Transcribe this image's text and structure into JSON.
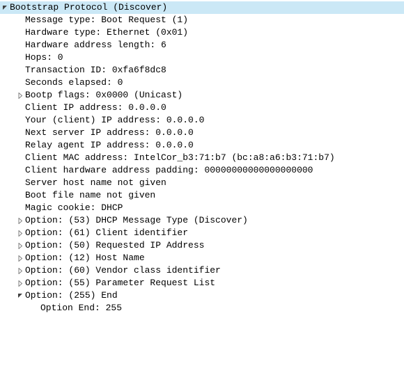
{
  "header": {
    "title": "Bootstrap Protocol (Discover)"
  },
  "fields": {
    "message_type": "Message type: Boot Request (1)",
    "hardware_type": "Hardware type: Ethernet (0x01)",
    "hw_addr_len": "Hardware address length: 6",
    "hops": "Hops: 0",
    "transaction_id": "Transaction ID: 0xfa6f8dc8",
    "seconds": "Seconds elapsed: 0",
    "bootp_flags": "Bootp flags: 0x0000 (Unicast)",
    "client_ip": "Client IP address: 0.0.0.0",
    "your_ip": "Your (client) IP address: 0.0.0.0",
    "next_server_ip": "Next server IP address: 0.0.0.0",
    "relay_ip": "Relay agent IP address: 0.0.0.0",
    "client_mac": "Client MAC address: IntelCor_b3:71:b7 (bc:a8:a6:b3:71:b7)",
    "hw_padding": "Client hardware address padding: 00000000000000000000",
    "server_host": "Server host name not given",
    "boot_file": "Boot file name not given",
    "magic_cookie": "Magic cookie: DHCP"
  },
  "options": {
    "o53": "Option: (53) DHCP Message Type (Discover)",
    "o61": "Option: (61) Client identifier",
    "o50": "Option: (50) Requested IP Address",
    "o12": "Option: (12) Host Name",
    "o60": "Option: (60) Vendor class identifier",
    "o55": "Option: (55) Parameter Request List",
    "o255": "Option: (255) End",
    "o255_end": "Option End: 255"
  }
}
